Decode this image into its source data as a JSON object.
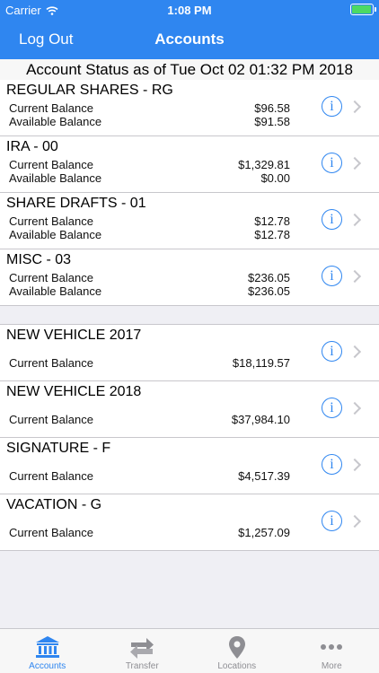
{
  "status_bar": {
    "carrier": "Carrier",
    "time": "1:08 PM",
    "battery_level": 0.95
  },
  "nav": {
    "left_button": "Log Out",
    "title": "Accounts"
  },
  "status_header": "Account Status as of Tue Oct 02 01:32 PM 2018",
  "shares": [
    {
      "name": "REGULAR SHARES - RG",
      "current_label": "Current Balance",
      "current": "$96.58",
      "available_label": "Available Balance",
      "available": "$91.58"
    },
    {
      "name": "IRA - 00",
      "current_label": "Current Balance",
      "current": "$1,329.81",
      "available_label": "Available Balance",
      "available": "$0.00"
    },
    {
      "name": "SHARE DRAFTS - 01",
      "current_label": "Current Balance",
      "current": "$12.78",
      "available_label": "Available Balance",
      "available": "$12.78"
    },
    {
      "name": "MISC - 03",
      "current_label": "Current Balance",
      "current": "$236.05",
      "available_label": "Available Balance",
      "available": "$236.05"
    }
  ],
  "loans": [
    {
      "name": "NEW VEHICLE 2017",
      "current_label": "Current Balance",
      "current": "$18,119.57"
    },
    {
      "name": "NEW VEHICLE 2018",
      "current_label": "Current Balance",
      "current": "$37,984.10"
    },
    {
      "name": "SIGNATURE - F",
      "current_label": "Current Balance",
      "current": "$4,517.39"
    },
    {
      "name": "VACATION - G",
      "current_label": "Current Balance",
      "current": "$1,257.09"
    }
  ],
  "info_glyph": "i",
  "tabs": [
    {
      "label": "Accounts",
      "icon": "bank-icon",
      "active": true
    },
    {
      "label": "Transfer",
      "icon": "transfer-arrows-icon",
      "active": false
    },
    {
      "label": "Locations",
      "icon": "location-pin-icon",
      "active": false
    },
    {
      "label": "More",
      "icon": "ellipsis-icon",
      "active": false
    }
  ],
  "colors": {
    "accent": "#2f86f0",
    "inactive": "#8e8e93",
    "separator": "#c8c7cc",
    "background": "#efeff4"
  }
}
